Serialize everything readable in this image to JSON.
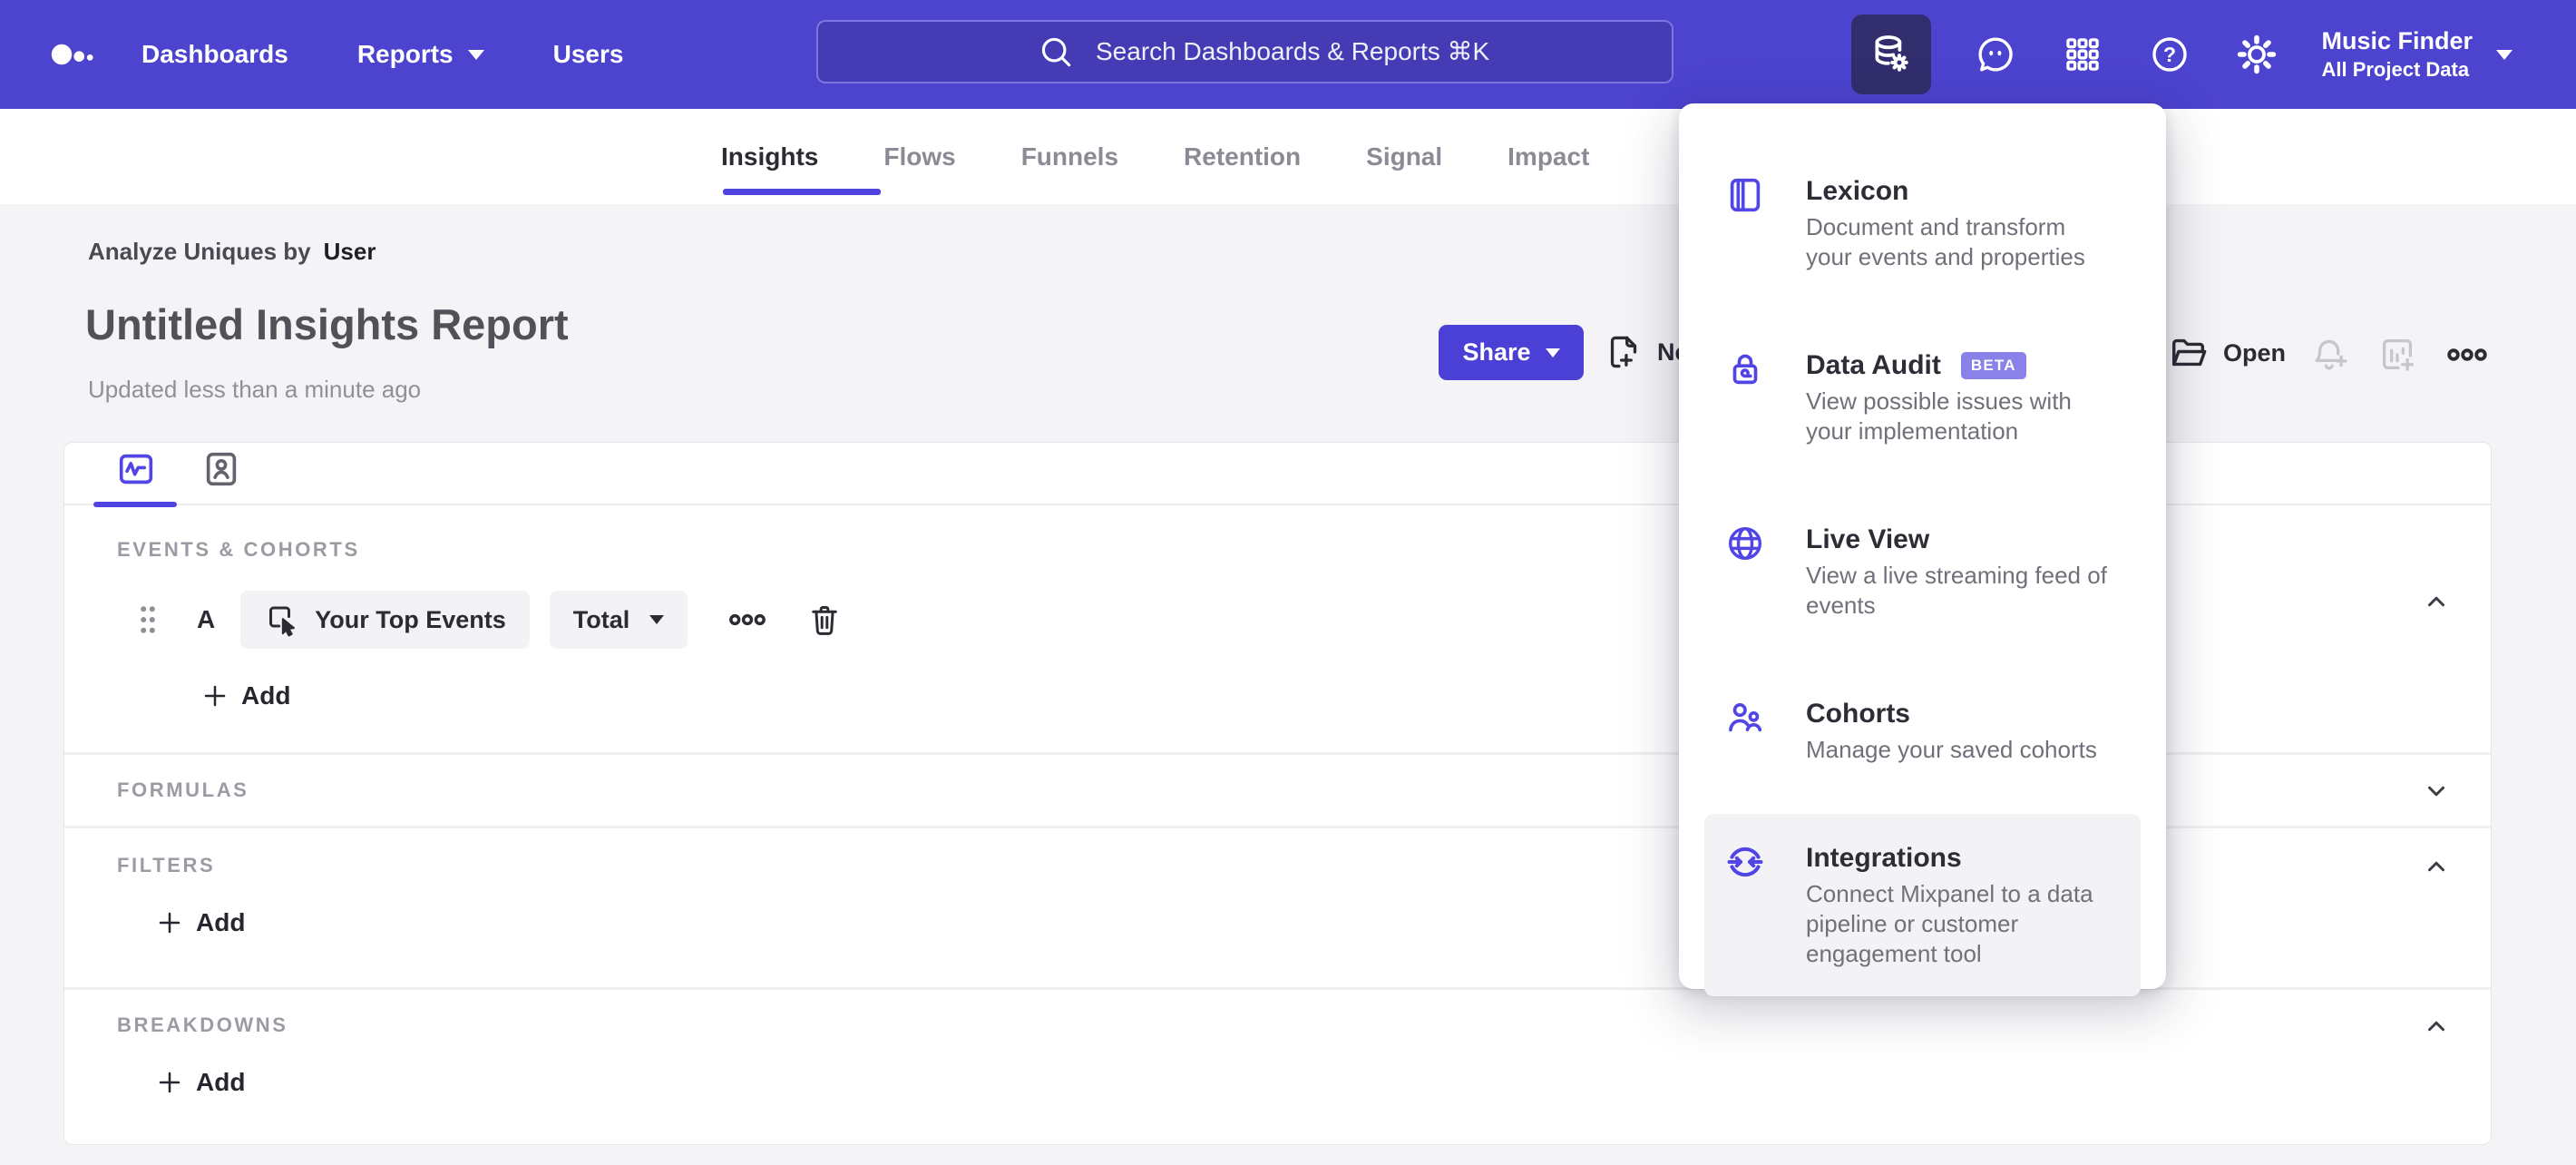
{
  "nav": {
    "items": [
      "Dashboards",
      "Reports",
      "Users"
    ],
    "search": {
      "placeholder": "Search Dashboards & Reports ⌘K"
    },
    "project": {
      "name": "Music Finder",
      "scope": "All Project Data"
    }
  },
  "tabs": {
    "items": [
      "Insights",
      "Flows",
      "Funnels",
      "Retention",
      "Signal",
      "Impact"
    ],
    "active": "Insights"
  },
  "report": {
    "analyze_label": "Analyze Uniques by",
    "analyze_value": "User",
    "title": "Untitled Insights Report",
    "updated": "Updated less than a minute ago"
  },
  "toolbar": {
    "share": "Share",
    "new": "New",
    "open": "Open"
  },
  "builder": {
    "events": {
      "header": "EVENTS & COHORTS",
      "row_label": "A",
      "event_name": "Your Top Events",
      "aggregation": "Total",
      "add": "Add"
    },
    "formulas": {
      "header": "FORMULAS"
    },
    "filters": {
      "header": "FILTERS",
      "add": "Add"
    },
    "breakdowns": {
      "header": "BREAKDOWNS",
      "add": "Add"
    }
  },
  "menu": {
    "items": [
      {
        "title": "Lexicon",
        "description": "Document and transform your events and properties"
      },
      {
        "title": "Data Audit",
        "badge": "BETA",
        "description": "View possible issues with your implementation"
      },
      {
        "title": "Live View",
        "description": "View a live streaming feed of events"
      },
      {
        "title": "Cohorts",
        "description": "Manage your saved cohorts"
      },
      {
        "title": "Integrations",
        "description": "Connect Mixpanel to a data pipeline or customer engagement tool"
      }
    ]
  },
  "colors": {
    "nav": "#4c43cf",
    "accent": "#4f44e0",
    "badge": "#8a82e8",
    "active_tile": "#322e6d"
  }
}
